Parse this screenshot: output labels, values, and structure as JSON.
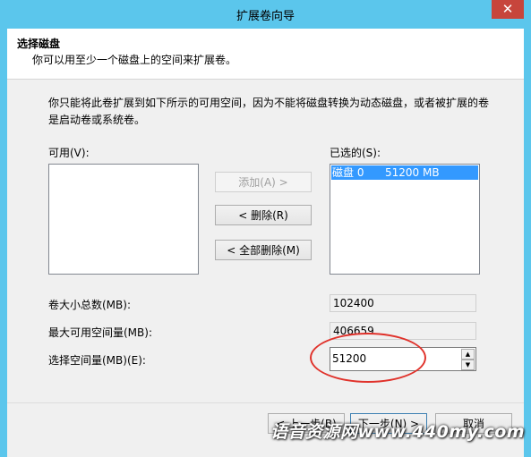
{
  "window": {
    "title": "扩展卷向导",
    "close_glyph": "✕"
  },
  "header": {
    "title": "选择磁盘",
    "subtitle": "你可以用至少一个磁盘上的空间来扩展卷。"
  },
  "description": "你只能将此卷扩展到如下所示的可用空间，因为不能将磁盘转换为动态磁盘，或者被扩展的卷是启动卷或系统卷。",
  "available": {
    "label": "可用(V):",
    "items": []
  },
  "selected": {
    "label": "已选的(S):",
    "items": [
      {
        "disk": "磁盘 0",
        "size": "51200 MB"
      }
    ]
  },
  "buttons": {
    "add": "添加(A) >",
    "remove": "< 删除(R)",
    "remove_all": "< 全部删除(M)"
  },
  "fields": {
    "total_label": "卷大小总数(MB):",
    "total_value": "102400",
    "max_label": "最大可用空间量(MB):",
    "max_value": "406659",
    "select_label": "选择空间量(MB)(E):",
    "select_value": "51200"
  },
  "footer": {
    "back": "< 上一步(B)",
    "next": "下一步(N) >",
    "cancel": "取消"
  },
  "watermark": "语音资源网www.440my.com",
  "colors": {
    "titlebar": "#5bc6ec",
    "close": "#c7453c",
    "selection": "#3399ff",
    "annotation": "#e0322b"
  }
}
